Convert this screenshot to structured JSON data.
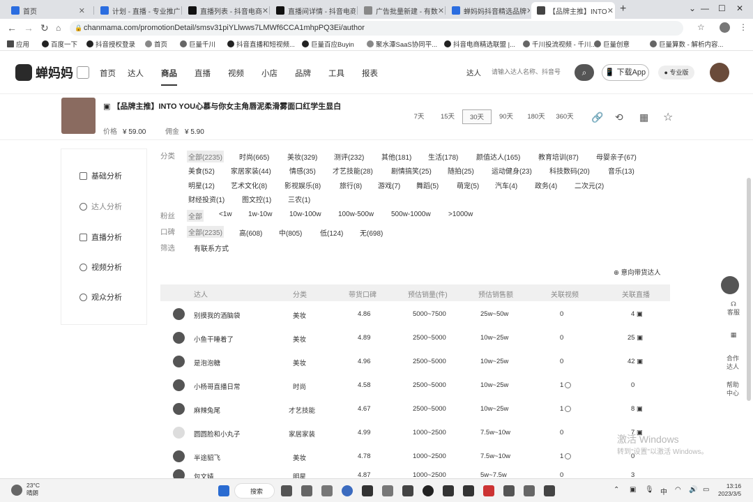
{
  "browser": {
    "tabs": [
      {
        "label": "首页",
        "color": "#2b6de0"
      },
      {
        "label": "计划 - 直播 - 专业推广",
        "color": "#2b6de0"
      },
      {
        "label": "直播列表 - 抖音电商",
        "color": "#111111"
      },
      {
        "label": "直播间详情 - 抖音电商",
        "color": "#111111"
      },
      {
        "label": "广告批量新建 - 有数",
        "color": "#888888"
      },
      {
        "label": "蝉妈妈抖音精选品牌",
        "color": "#2b6de0"
      },
      {
        "label": "【品牌主推】INTO",
        "color": "#444444"
      }
    ],
    "new_tab": "+",
    "url": "chanmama.com/promotionDetail/smsv31piYLlwws7LMWf6CCA1mhpPQ3Ei/author",
    "bookmarks": [
      "应用",
      "百度一下",
      "抖音授权登录",
      "首页",
      "巨量千川",
      "抖音直播和短视频...",
      "巨量百应Buyin",
      "聚水潭SaaS协同平...",
      "抖音电商精选联盟 |...",
      "千川投流视频 - 千川...",
      "巨量创意",
      "巨量算数 - 解析内容..."
    ]
  },
  "header": {
    "brand": "蝉妈妈",
    "nav": [
      "首页",
      "达人",
      "商品",
      "直播",
      "视频",
      "小店",
      "品牌",
      "工具",
      "报表"
    ],
    "active_nav": "商品",
    "search_label": "达人",
    "search_placeholder": "请输入达人名称、抖音号",
    "download": "下载App",
    "pro": "专业版"
  },
  "product": {
    "title": "【品牌主推】INTO YOU心慕与你女主角唇泥柔滑雾面口红学生显白",
    "price_label": "价格",
    "price": "¥ 59.00",
    "commission_label": "佣金",
    "commission": "¥ 5.90",
    "ranges": [
      "7天",
      "15天",
      "30天",
      "90天",
      "180天",
      "360天"
    ],
    "active_range": "30天"
  },
  "sidenav": [
    "基础分析",
    "达人分析",
    "直播分析",
    "视频分析",
    "观众分析"
  ],
  "filters": {
    "category_label": "分类",
    "categories": [
      "全部(2235)",
      "时尚(665)",
      "美妆(329)",
      "测评(232)",
      "其他(181)",
      "生活(178)",
      "颜值达人(165)",
      "教育培训(87)",
      "母婴亲子(67)",
      "美食(52)",
      "家居家装(44)",
      "情感(35)",
      "才艺技能(28)",
      "剧情搞笑(25)",
      "随拍(25)",
      "运动健身(23)",
      "科技数码(20)",
      "音乐(13)",
      "明星(12)",
      "艺术文化(8)",
      "影视娱乐(8)",
      "旅行(8)",
      "游戏(7)",
      "舞蹈(5)",
      "萌宠(5)",
      "汽车(4)",
      "政务(4)",
      "二次元(2)",
      "财经投资(1)",
      "图文控(1)",
      "三农(1)"
    ],
    "fans_label": "粉丝",
    "fans": [
      "全部",
      "<1w",
      "1w-10w",
      "10w-100w",
      "100w-500w",
      "500w-1000w",
      ">1000w"
    ],
    "rep_label": "口碑",
    "rep": [
      "全部(2235)",
      "高(608)",
      "中(805)",
      "低(124)",
      "无(698)"
    ],
    "screen_label": "筛选",
    "screen": [
      "有联系方式"
    ]
  },
  "intent_button": "意向带货达人",
  "table": {
    "headers": [
      "达人",
      "分类",
      "带货口碑",
      "预估销量(件)",
      "预估销售额",
      "关联视频",
      "关联直播"
    ],
    "rows": [
      {
        "name": "别摸我的酒脑袋",
        "cat": "美妆",
        "score": "4.86",
        "vol": "5000~7500",
        "sales": "25w~50w",
        "video": "0",
        "live": "4"
      },
      {
        "name": "小鱼干睡着了",
        "cat": "美妆",
        "score": "4.89",
        "vol": "2500~5000",
        "sales": "10w~25w",
        "video": "0",
        "live": "25"
      },
      {
        "name": "是泡泡糖",
        "cat": "美妆",
        "score": "4.96",
        "vol": "2500~5000",
        "sales": "10w~25w",
        "video": "0",
        "live": "42"
      },
      {
        "name": "小杨哥直播日常",
        "cat": "时尚",
        "score": "4.58",
        "vol": "2500~5000",
        "sales": "10w~25w",
        "video": "1",
        "live": "0"
      },
      {
        "name": "麻辣兔尾",
        "cat": "才艺技能",
        "score": "4.67",
        "vol": "2500~5000",
        "sales": "10w~25w",
        "video": "1",
        "live": "8"
      },
      {
        "name": "圆圆脸和小丸子",
        "cat": "家居家装",
        "score": "4.99",
        "vol": "1000~2500",
        "sales": "7.5w~10w",
        "video": "0",
        "live": "7"
      },
      {
        "name": "半途貂飞",
        "cat": "美妆",
        "score": "4.78",
        "vol": "1000~2500",
        "sales": "7.5w~10w",
        "video": "1",
        "live": "0"
      },
      {
        "name": "包文婧",
        "cat": "明星",
        "score": "4.87",
        "vol": "1000~2500",
        "sales": "5w~7.5w",
        "video": "0",
        "live": "3"
      }
    ]
  },
  "right_float": [
    "客服",
    "合作达人",
    "帮助中心"
  ],
  "watermark": {
    "line1": "激活 Windows",
    "line2": "转到\"设置\"以激活 Windows。"
  },
  "taskbar": {
    "temp": "23°C",
    "weather": "晴朗",
    "search": "搜索",
    "ime": "中",
    "time": "13:16",
    "date": "2023/3/5"
  }
}
